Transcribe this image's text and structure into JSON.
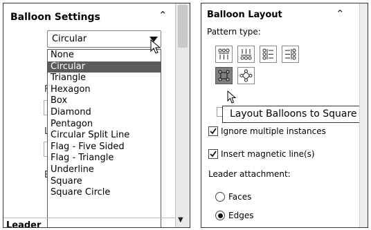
{
  "left_panel": {
    "title": "Balloon Settings",
    "collapse_icon": "chevron-up-icon",
    "shape_select": {
      "value": "Circular",
      "options": [
        "None",
        "Circular",
        "Triangle",
        "Hexagon",
        "Box",
        "Diamond",
        "Pentagon",
        "Circular Split Line",
        "Flag - Five Sided",
        "Flag - Triangle",
        "Underline",
        "Square",
        "Square Circle"
      ],
      "selected_index": 1
    },
    "leader_section_partial": "Leader"
  },
  "right_panel": {
    "title": "Balloon Layout",
    "collapse_icon": "chevron-up-icon",
    "pattern_label": "Pattern type:",
    "pattern_buttons": [
      {
        "icon": "layout-top-icon",
        "active": false
      },
      {
        "icon": "layout-bottom-icon",
        "active": false
      },
      {
        "icon": "layout-left-icon",
        "active": false
      },
      {
        "icon": "layout-right-icon",
        "active": false
      },
      {
        "icon": "layout-square-icon",
        "active": true
      },
      {
        "icon": "layout-circular-icon",
        "active": false
      }
    ],
    "tooltip": "Layout Balloons to Square",
    "ignore_multiple": {
      "label": "Ignore multiple instances",
      "checked": true
    },
    "insert_magnetic": {
      "label": "Insert magnetic line(s)",
      "checked": true
    },
    "leader_attachment_label": "Leader attachment:",
    "faces": {
      "label": "Faces",
      "selected": false
    },
    "edges": {
      "label": "Edges",
      "selected": true
    }
  },
  "colors": {
    "selection_bg": "#5c5c5c",
    "active_button_bg": "#7f7f7f",
    "panel_border": "#333333"
  }
}
